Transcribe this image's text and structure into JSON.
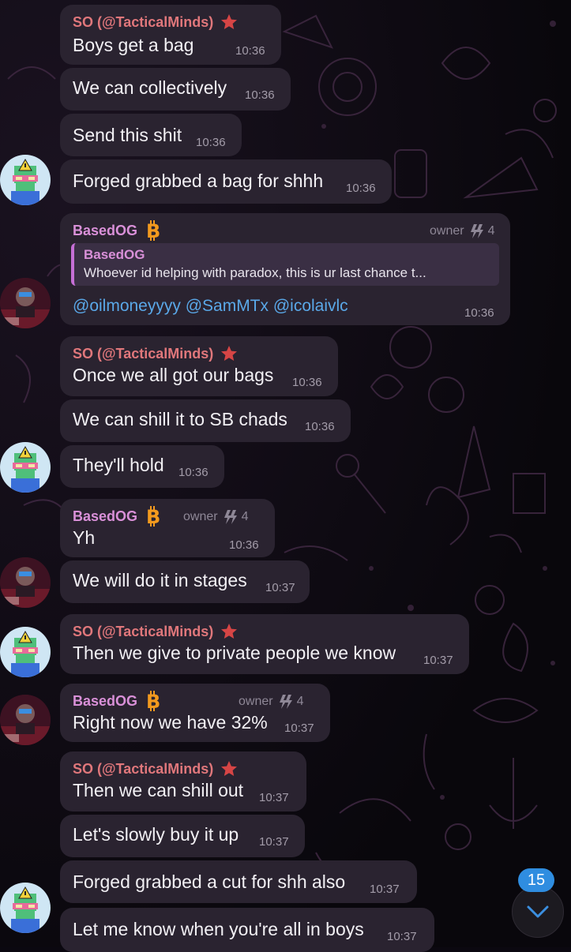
{
  "senders": {
    "so": "SO (@TacticalMinds)",
    "based": "BasedOG"
  },
  "roles": {
    "owner": "owner",
    "level": "4"
  },
  "colors": {
    "so_name": "#e0777b",
    "based_name": "#d990d8",
    "bubble": "#2a2330",
    "mention": "#5aa8e8",
    "badge": "#2f8de0"
  },
  "messages": [
    {
      "text": "Boys get a bag",
      "time": "10:36"
    },
    {
      "text": "We can collectively",
      "time": "10:36"
    },
    {
      "text": "Send this shit",
      "time": "10:36"
    },
    {
      "text": "Forged grabbed a bag for shhh",
      "time": "10:36"
    },
    {
      "reply_name": "BasedOG",
      "reply_text": "Whoever id helping with paradox, this is ur last chance t...",
      "mentions": "@oilmoneyyyy @SamMTx @icolaivlc",
      "time": "10:36"
    },
    {
      "text": "Once we all got our bags",
      "time": "10:36"
    },
    {
      "text": "We can shill it to SB chads",
      "time": "10:36"
    },
    {
      "text": "They'll hold",
      "time": "10:36"
    },
    {
      "text": "Yh",
      "time": "10:36"
    },
    {
      "text": "We will do it in stages",
      "time": "10:37"
    },
    {
      "text": "Then we give to private people we know",
      "time": "10:37"
    },
    {
      "text": "Right now we have 32%",
      "time": "10:37"
    },
    {
      "text": "Then we can shill out",
      "time": "10:37"
    },
    {
      "text": "Let's slowly buy it up",
      "time": "10:37"
    },
    {
      "text": "Forged grabbed a cut for shh also",
      "time": "10:37"
    },
    {
      "text": "Let me know when you're all in boys",
      "time": "10:37"
    }
  ],
  "icons": {
    "star_badge": "red-star-icon",
    "btc_badge": "bitcoin-icon",
    "level": "lightning-level-icon",
    "scroll_down": "chevron-down-icon"
  },
  "unread_count": "15"
}
